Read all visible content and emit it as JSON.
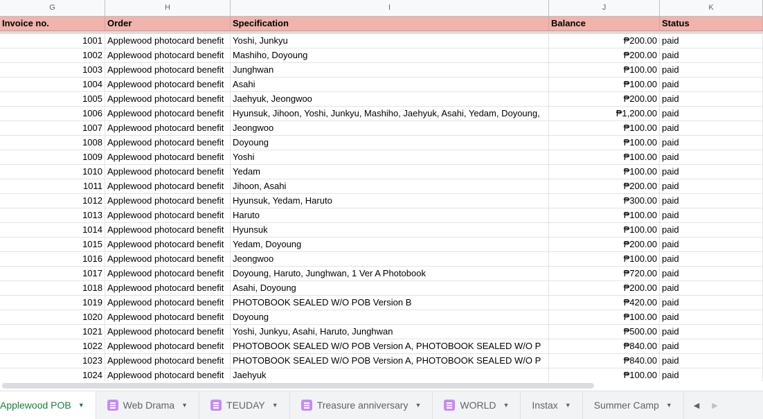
{
  "columns": [
    "G",
    "H",
    "I",
    "J",
    "K"
  ],
  "headers": [
    "Invoice no.",
    "Order",
    "Specification",
    "Balance",
    "Status"
  ],
  "rows": [
    [
      "1001",
      "Applewood photocard benefit",
      "Yoshi, Junkyu",
      "₱200.00",
      "paid"
    ],
    [
      "1002",
      "Applewood photocard benefit",
      "Mashiho, Doyoung",
      "₱200.00",
      "paid"
    ],
    [
      "1003",
      "Applewood photocard benefit",
      "Junghwan",
      "₱100.00",
      "paid"
    ],
    [
      "1004",
      "Applewood photocard benefit",
      "Asahi",
      "₱100.00",
      "paid"
    ],
    [
      "1005",
      "Applewood photocard benefit",
      "Jaehyuk, Jeongwoo",
      "₱200.00",
      "paid"
    ],
    [
      "1006",
      "Applewood photocard benefit",
      "Hyunsuk, Jihoon, Yoshi, Junkyu, Mashiho, Jaehyuk, Asahi, Yedam, Doyoung,",
      "₱1,200.00",
      "paid"
    ],
    [
      "1007",
      "Applewood photocard benefit",
      "Jeongwoo",
      "₱100.00",
      "paid"
    ],
    [
      "1008",
      "Applewood photocard benefit",
      "Doyoung",
      "₱100.00",
      "paid"
    ],
    [
      "1009",
      "Applewood photocard benefit",
      "Yoshi",
      "₱100.00",
      "paid"
    ],
    [
      "1010",
      "Applewood photocard benefit",
      "Yedam",
      "₱100.00",
      "paid"
    ],
    [
      "1011",
      "Applewood photocard benefit",
      "Jihoon, Asahi",
      "₱200.00",
      "paid"
    ],
    [
      "1012",
      "Applewood photocard benefit",
      "Hyunsuk, Yedam, Haruto",
      "₱300.00",
      "paid"
    ],
    [
      "1013",
      "Applewood photocard benefit",
      "Haruto",
      "₱100.00",
      "paid"
    ],
    [
      "1014",
      "Applewood photocard benefit",
      "Hyunsuk",
      "₱100.00",
      "paid"
    ],
    [
      "1015",
      "Applewood photocard benefit",
      "Yedam, Doyoung",
      "₱200.00",
      "paid"
    ],
    [
      "1016",
      "Applewood photocard benefit",
      "Jeongwoo",
      "₱100.00",
      "paid"
    ],
    [
      "1017",
      "Applewood photocard benefit",
      "Doyoung, Haruto, Junghwan, 1 Ver A Photobook",
      "₱720.00",
      "paid"
    ],
    [
      "1018",
      "Applewood photocard benefit",
      "Asahi, Doyoung",
      "₱200.00",
      "paid"
    ],
    [
      "1019",
      "Applewood photocard benefit",
      "PHOTOBOOK SEALED W/O POB Version B",
      "₱420.00",
      "paid"
    ],
    [
      "1020",
      "Applewood photocard benefit",
      "Doyoung",
      "₱100.00",
      "paid"
    ],
    [
      "1021",
      "Applewood photocard benefit",
      "Yoshi, Junkyu, Asahi, Haruto, Junghwan",
      "₱500.00",
      "paid"
    ],
    [
      "1022",
      "Applewood photocard benefit",
      "PHOTOBOOK SEALED W/O POB Version A, PHOTOBOOK SEALED W/O P",
      "₱840.00",
      "paid"
    ],
    [
      "1023",
      "Applewood photocard benefit",
      "PHOTOBOOK SEALED W/O POB Version A, PHOTOBOOK SEALED W/O P",
      "₱840.00",
      "paid"
    ],
    [
      "1024",
      "Applewood photocard benefit",
      "Jaehyuk",
      "₱100.00",
      "paid"
    ]
  ],
  "tabs": [
    {
      "label": "Applewood POB",
      "active": true,
      "icon": false
    },
    {
      "label": "Web Drama",
      "icon": true
    },
    {
      "label": "TEUDAY",
      "icon": true
    },
    {
      "label": "Treasure anniversary",
      "icon": true
    },
    {
      "label": "WORLD",
      "icon": true
    },
    {
      "label": "Instax",
      "icon": false
    },
    {
      "label": "Summer Camp",
      "icon": false
    }
  ],
  "colors": {
    "header_bg": "#f0b4ac",
    "active_tab": "#188038",
    "tab_icon": "#c58af9"
  }
}
